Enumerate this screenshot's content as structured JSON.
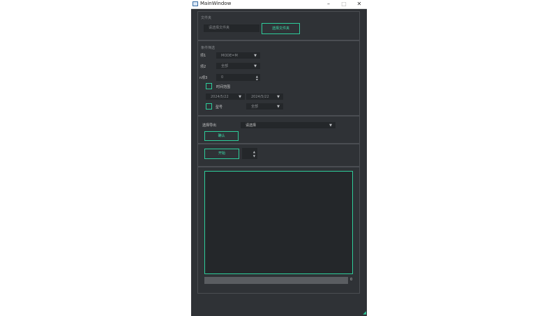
{
  "window": {
    "title": "MainWindow",
    "minimize": "–",
    "maximize": "□",
    "close": "✕"
  },
  "folder": {
    "group_label": "文件夹",
    "path_placeholder": "请选择文件夹",
    "select_button": "选择文件夹"
  },
  "filter": {
    "group_label": "条件筛选",
    "row1_label": "项1",
    "row1_value": "MODE=M",
    "row2_label": "项2",
    "row2_value": "全部",
    "row3_label": "n项3",
    "row3_value": "0",
    "time_range_label": "时间范围",
    "start_date": "2024/5/22",
    "end_date": "2024/5/22",
    "model_label": "型号",
    "model_value": "全部"
  },
  "export": {
    "label": "选择导出",
    "combo_value": "请选择",
    "confirm_button": "确认"
  },
  "run": {
    "start_button": "开始",
    "spin_value": ""
  },
  "progress": {
    "value": 0,
    "text": "0"
  },
  "colors": {
    "accent": "#2ecc9a",
    "panel": "#2f3236",
    "field": "#24272a"
  }
}
